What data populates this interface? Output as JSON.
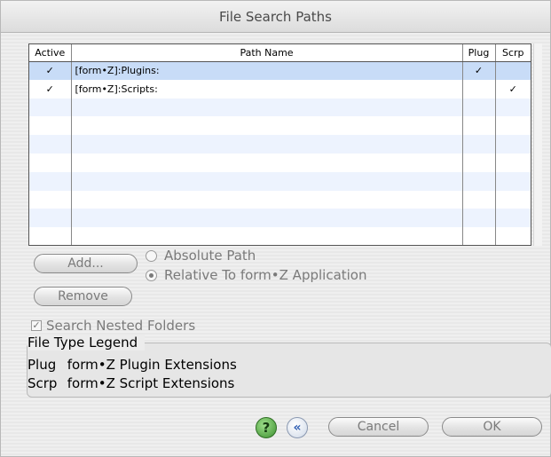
{
  "window": {
    "title": "File Search Paths"
  },
  "table": {
    "columns": [
      "Active",
      "Path Name",
      "Plug",
      "Scrp"
    ],
    "rows": [
      {
        "active": "✓",
        "path": "[form•Z]:Plugins:",
        "plug": "✓",
        "scrp": ""
      },
      {
        "active": "✓",
        "path": "[form•Z]:Scripts:",
        "plug": "",
        "scrp": "✓"
      }
    ]
  },
  "buttons": {
    "add": "Add...",
    "remove": "Remove",
    "cancel": "Cancel",
    "ok": "OK"
  },
  "options": {
    "absolute_path": "Absolute Path",
    "relative_path": "Relative To form•Z Application",
    "selected": "relative"
  },
  "search_nested": {
    "label": "Search Nested Folders",
    "checked": true,
    "check_glyph": "✓"
  },
  "legend": {
    "title": "File Type Legend",
    "items": [
      {
        "code": "Plug",
        "desc": "form•Z Plugin Extensions"
      },
      {
        "code": "Scrp",
        "desc": "form•Z Script Extensions"
      }
    ]
  },
  "icons": {
    "help": "?",
    "back": "«"
  },
  "colors": {
    "selected_row": "#c8dcf7",
    "stripe_row": "#edf3fe",
    "disabled_text": "#7a7a7a"
  }
}
